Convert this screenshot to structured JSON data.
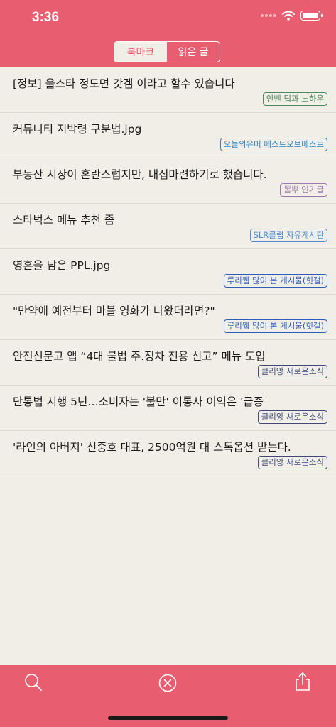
{
  "status_bar": {
    "time": "3:36"
  },
  "segment": {
    "tabs": [
      "북마크",
      "읽은 글"
    ],
    "selected": 0
  },
  "articles": [
    {
      "title": "[정보] 올스타 정도면 갓겜 이라고 할수 있습니다",
      "source": "인벤 팁과 노하우",
      "color": "#4f8a5e"
    },
    {
      "title": "커뮤니티 지박령 구분법.jpg",
      "source": "오늘의유머 베스트오브베스트",
      "color": "#2c86c4"
    },
    {
      "title": "부동산 시장이 혼란스럽지만, 내집마련하기로 했습니다.",
      "source": "뽐뿌 인기글",
      "color": "#9e7bab"
    },
    {
      "title": "스타벅스 메뉴 추천 좀",
      "source": "SLR클럽 자유게시판",
      "color": "#4f90d0"
    },
    {
      "title": "영혼을 담은 PPL.jpg",
      "source": "루리웹 많이 본 게시물(힛갤)",
      "color": "#2f5fbd"
    },
    {
      "title": "\"만약에 예전부터 마블 영화가 나왔더라면?\"",
      "source": "루리웹 많이 본 게시물(힛갤)",
      "color": "#2f5fbd"
    },
    {
      "title": "안전신문고 앱 “4대 불법 주.정차 전용 신고” 메뉴 도입",
      "source": "클리앙 새로운소식",
      "color": "#3e4a78"
    },
    {
      "title": "단통법 시행 5년…소비자는 '불만' 이통사 이익은 '급증",
      "source": "클리앙 새로운소식",
      "color": "#3e4a78"
    },
    {
      "title": "'라인의 아버지' 신중호 대표, 2500억원 대 스톡옵션 받는다.",
      "source": "클리앙 새로운소식",
      "color": "#3e4a78"
    }
  ],
  "colors": {
    "accent": "#e85d6f",
    "background": "#f0eee6"
  },
  "icons": {
    "search": "search-icon",
    "clear": "clear-icon",
    "share": "share-icon"
  }
}
